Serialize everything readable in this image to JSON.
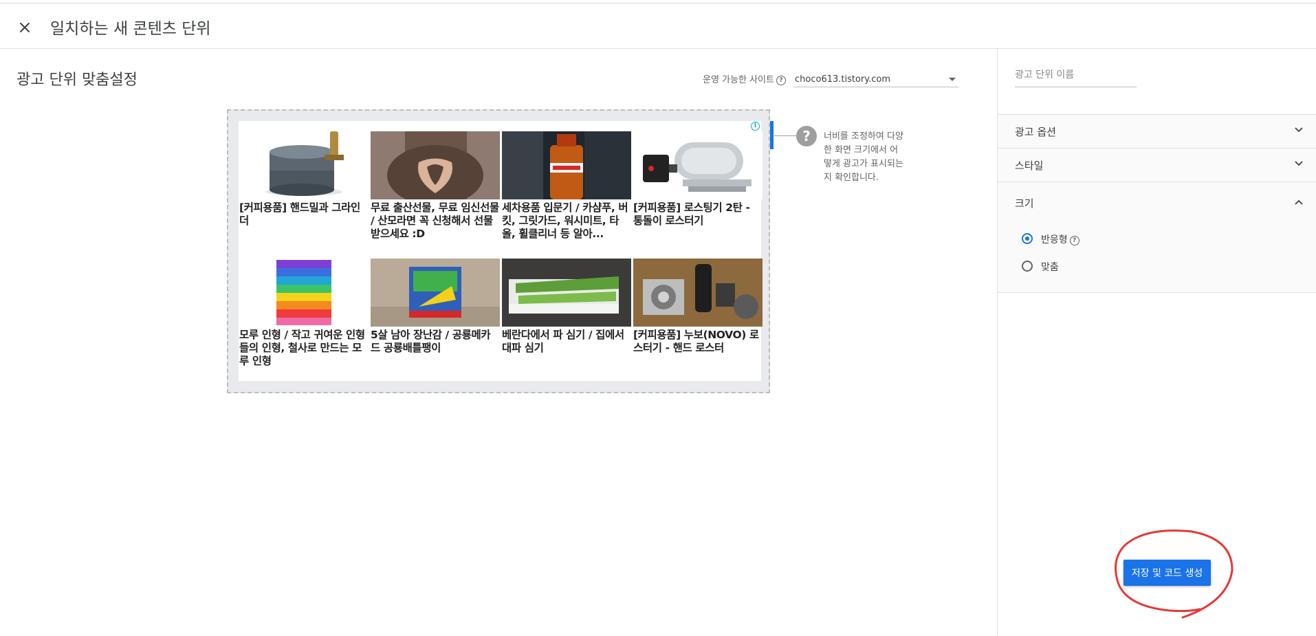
{
  "header": {
    "title": "일치하는 새 콘텐츠 단위",
    "close_icon": "close-icon"
  },
  "main": {
    "section_title": "광고 단위 맞춤설정",
    "site_label": "운영 가능한 사이트",
    "site_value": "choco613.tistory.com",
    "resize_tip": "너비를 조정하여 다양한 화면 크기에서 어떻게 광고가 표시되는지 확인합니다."
  },
  "ad_preview": {
    "adchoices_glyph": "i",
    "cards": [
      {
        "title": "[커피용품] 핸드밀과 그라인더",
        "thumb": "coffee-grinder"
      },
      {
        "title": "무료 출산선물, 무료 임신선물 / 산모라면 꼭 신청해서 선물 받으세요 :D",
        "thumb": "pregnancy-hands"
      },
      {
        "title": "세차용품 입문기 / 카샴푸, 버킷, 그릿가드, 워시미트, 타올, 휠클리너 등 알아...",
        "thumb": "car-wash-bottle"
      },
      {
        "title": "[커피용품] 로스팅기 2탄 - 통돌이 로스터기",
        "thumb": "coffee-roaster"
      },
      {
        "title": "모루 인형 / 작고 귀여운 인형들의 인형, 철사로 만드는 모루 인형",
        "thumb": "pipe-cleaners"
      },
      {
        "title": "5살 남아 장난감 / 공룡메카드 공룡배틀팽이",
        "thumb": "toy-box"
      },
      {
        "title": "베란다에서 파 심기 / 집에서 대파 심기",
        "thumb": "green-onions"
      },
      {
        "title": "[커피용품] 누보(NOVO) 로스터기 - 핸드 로스터",
        "thumb": "hand-roaster"
      }
    ]
  },
  "sidebar": {
    "ad_unit_name_placeholder": "광고 단위 이름",
    "sections": [
      {
        "label": "광고 옵션",
        "expanded": false
      },
      {
        "label": "스타일",
        "expanded": false
      },
      {
        "label": "크기",
        "expanded": true
      }
    ],
    "size_options": [
      {
        "label": "반응형",
        "checked": true
      },
      {
        "label": "맞춤",
        "checked": false
      }
    ]
  },
  "actions": {
    "save_label": "저장 및 코드 생성"
  },
  "colors": {
    "accent": "#1a73e8",
    "annotation": "#e53935"
  }
}
